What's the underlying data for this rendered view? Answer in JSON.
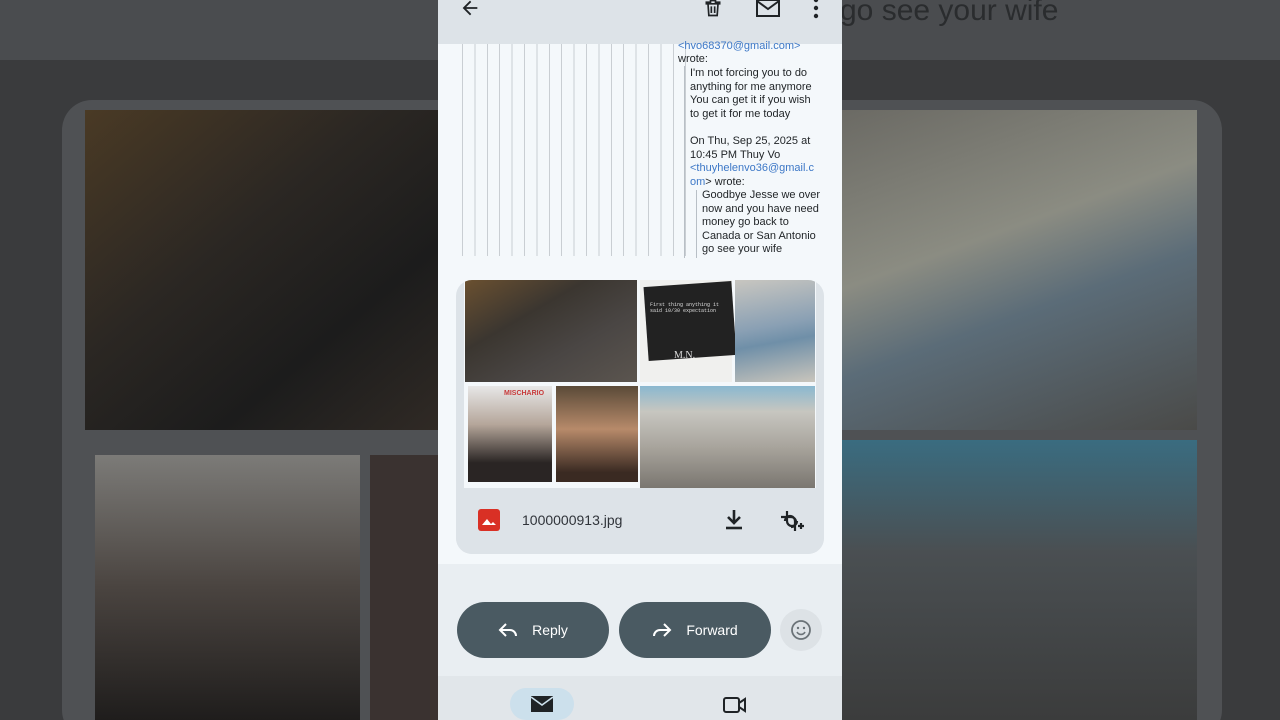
{
  "background": {
    "top_text": "go see your wife"
  },
  "toolbar": {
    "back_icon": "arrow-left-icon",
    "delete_icon": "trash-icon",
    "mark_unread_icon": "mail-icon",
    "more_icon": "more-vertical-icon"
  },
  "email": {
    "quote1": {
      "sender_email": "<hvo68370@gmail.com>",
      "wrote": "wrote:",
      "lines": [
        "I'm not forcing you to do",
        "anything for me anymore",
        "You can get it if you wish",
        "to get it for me today"
      ]
    },
    "quote2": {
      "header": [
        "On Thu, Sep 25, 2025 at",
        "10:45 PM Thuy Vo"
      ],
      "sender_email_part1": "<thuyhelenvo36@gmail.c",
      "sender_email_part2": "om",
      "wrote": "> wrote:",
      "lines": [
        "Goodbye Jesse we over",
        "now and you have need",
        "money go back to",
        "Canada or San Antonio",
        "go see your wife"
      ]
    }
  },
  "attachment": {
    "filename": "1000000913.jpg",
    "collage_text": "First thing anything it said 10/30 expectation",
    "collage_label": "MISCHARIO",
    "collage_mark": "M.N."
  },
  "actions": {
    "reply_label": "Reply",
    "forward_label": "Forward"
  },
  "colors": {
    "pill": "#4a5a62",
    "link": "#3d78c7",
    "image_icon": "#d93025"
  }
}
